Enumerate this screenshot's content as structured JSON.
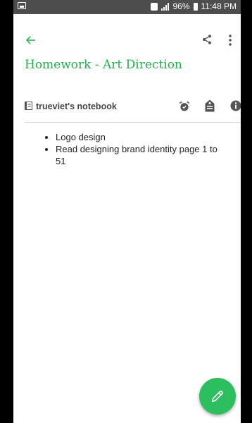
{
  "status_bar": {
    "battery": "96%",
    "time": "11:48 PM"
  },
  "note": {
    "title": "Homework - Art Direction"
  },
  "notebook": {
    "name": "trueviet's notebook"
  },
  "content": {
    "items": [
      "Logo design",
      "Read designing brand identity page 1 to 51"
    ]
  },
  "colors": {
    "accent": "#22b14c",
    "fab": "#2dbe60",
    "status_bar": "#4d4d4d"
  },
  "icons": {
    "back": "arrow-left-icon",
    "share": "share-icon",
    "more": "more-vertical-icon",
    "notebook": "notebook-icon",
    "reminder": "alarm-clock-icon",
    "tag": "tag-icon",
    "info": "info-icon",
    "fab": "pencil-icon"
  }
}
